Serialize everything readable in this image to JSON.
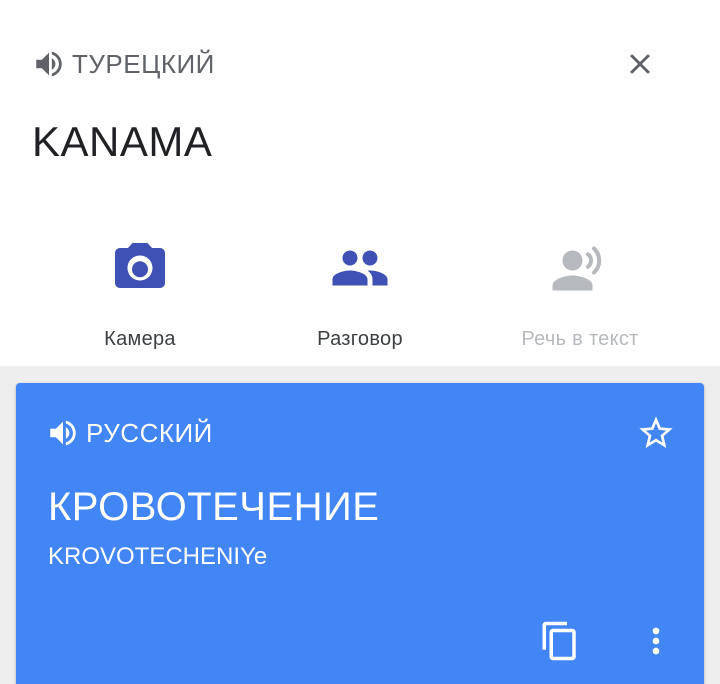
{
  "source": {
    "language": "ТУРЕЦКИЙ",
    "text": "KANAMA"
  },
  "actions": [
    {
      "label": "Камера",
      "icon": "camera-icon",
      "enabled": true
    },
    {
      "label": "Разговор",
      "icon": "conversation-icon",
      "enabled": true
    },
    {
      "label": "Речь в текст",
      "icon": "transcribe-icon",
      "enabled": false
    }
  ],
  "result": {
    "language": "РУССКИЙ",
    "translation": "КРОВОТЕЧЕНИЕ",
    "transliteration": "KROVOTECHENIYe"
  },
  "colors": {
    "accent": "#3f51b5",
    "card": "#4285f4",
    "disabled": "#b6b9bd",
    "icon_gray": "#5f6368"
  }
}
